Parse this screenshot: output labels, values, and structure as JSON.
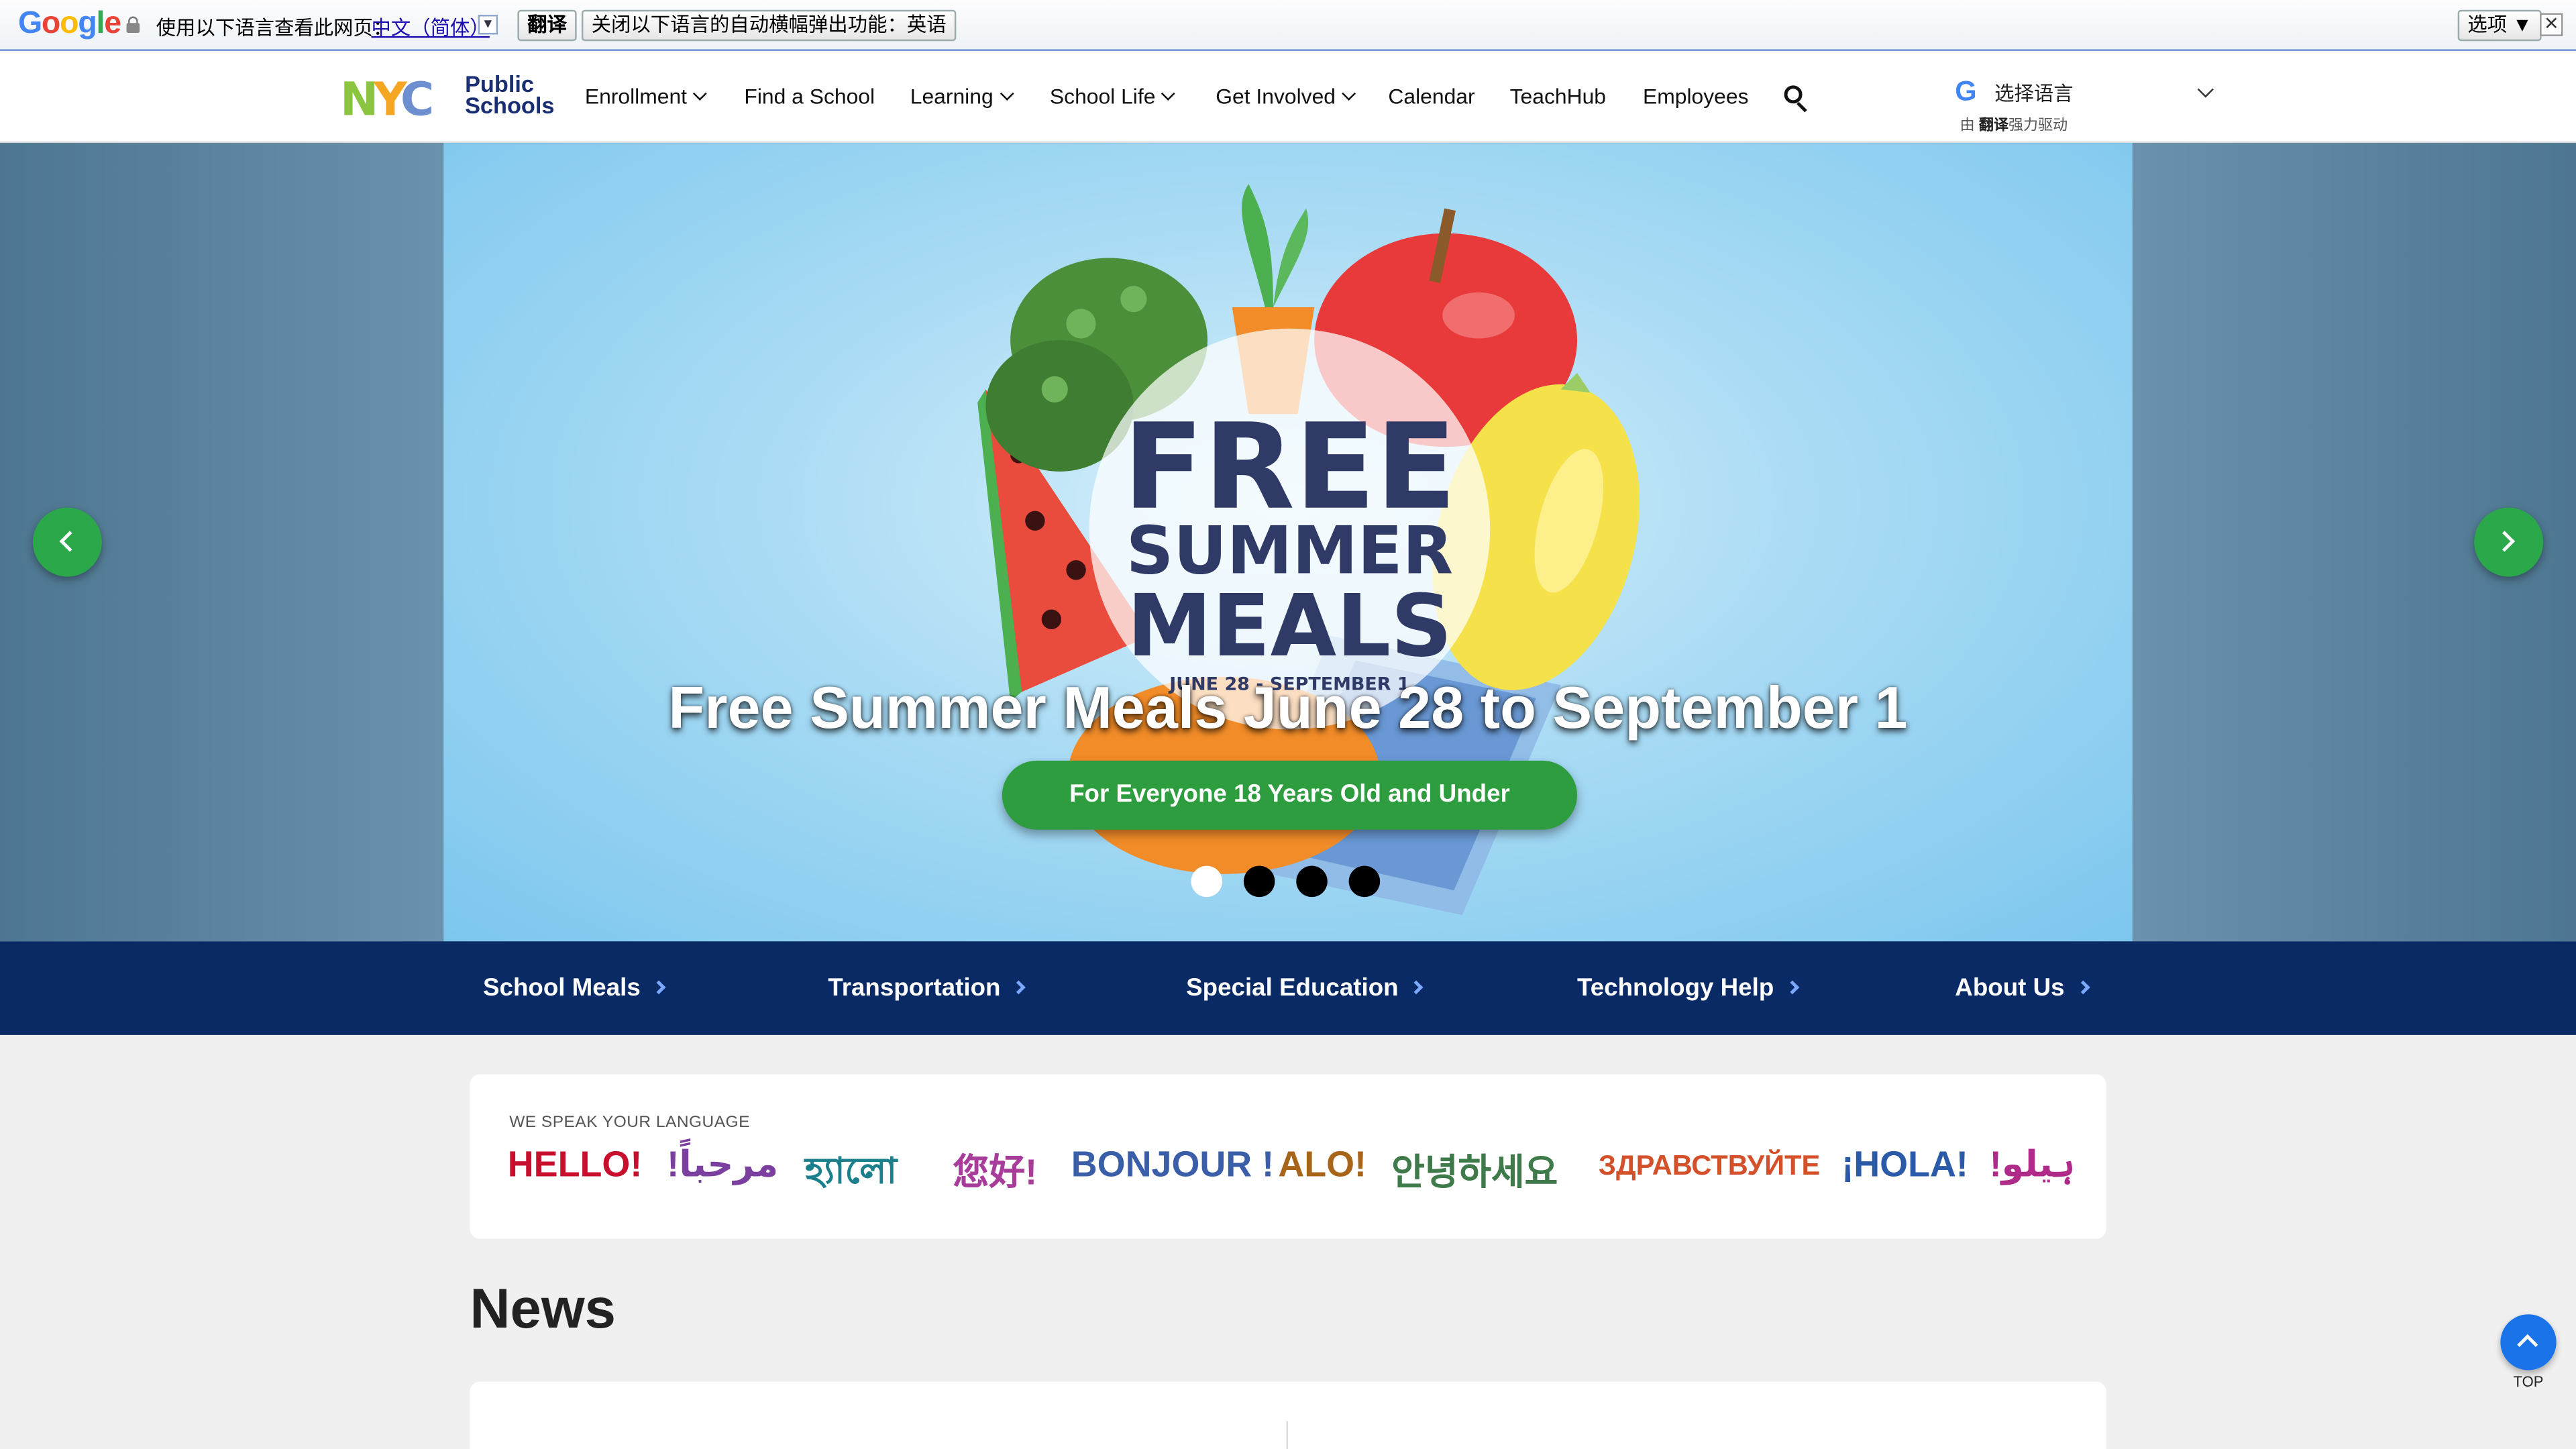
{
  "translate_bar": {
    "logo": "Google",
    "prompt": "使用以下语言查看此网页：",
    "language": "中文（简体）",
    "translate_button": "翻译",
    "close_button": "关闭以下语言的自动横幅弹出功能：英语",
    "options_button": "选项 ▼",
    "close_icon": "✕"
  },
  "header": {
    "logo_text": "NYC",
    "logo_sub_1": "Public",
    "logo_sub_2": "Schools",
    "nav": [
      "Enrollment",
      "Find a School",
      "Learning",
      "School Life",
      "Get Involved",
      "Calendar",
      "TeachHub",
      "Employees"
    ],
    "language_picker": {
      "label": "选择语言",
      "powered_prefix": "由",
      "powered_brand": "翻译",
      "powered_suffix": "强力驱动"
    }
  },
  "hero": {
    "art_text_1": "FREE",
    "art_text_2": "SUMMER",
    "art_text_3": "MEALS",
    "art_dates": "JUNE 28 - SEPTEMBER 1",
    "caption": "Free Summer Meals June 28 to September 1",
    "cta": "For Everyone 18 Years Old and Under",
    "slide_count": 4,
    "active_slide": 1
  },
  "quick_links": [
    "School Meals",
    "Transportation",
    "Special Education",
    "Technology Help",
    "About Us"
  ],
  "languages_card": {
    "kicker": "WE SPEAK YOUR LANGUAGE",
    "greetings": [
      {
        "text": "HELLO!",
        "color": "#c8102e"
      },
      {
        "text": "!مرحباً",
        "color": "#7b3fa0"
      },
      {
        "text": "হ্যালো",
        "color": "#1b7f8c"
      },
      {
        "text": "您好!",
        "color": "#a83c9a"
      },
      {
        "text": "BONJOUR !",
        "color": "#3a5ea8"
      },
      {
        "text": "ALO!",
        "color": "#a8651a"
      },
      {
        "text": "안녕하세요",
        "color": "#3e7a4a"
      },
      {
        "text": "ЗДРАВСТВУЙТЕ",
        "color": "#d4502a"
      },
      {
        "text": "¡HOLA!",
        "color": "#2a5aa8"
      },
      {
        "text": "!ہیلو",
        "color": "#b02a8a"
      }
    ]
  },
  "news": {
    "title": "News"
  },
  "back_to_top": "TOP"
}
